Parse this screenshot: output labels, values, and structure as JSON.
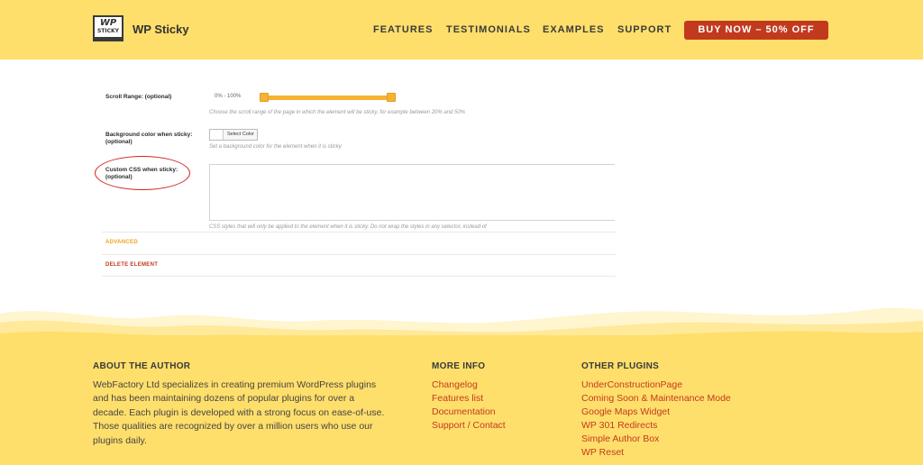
{
  "header": {
    "logo_line1": "WP",
    "logo_line2": "STICKY",
    "brand": "WP Sticky",
    "nav": [
      "FEATURES",
      "TESTIMONIALS",
      "EXAMPLES",
      "SUPPORT"
    ],
    "buy_label": "BUY NOW – 50% OFF"
  },
  "settings": {
    "scroll_range": {
      "label": "Scroll Range: (optional)",
      "value_text": "0% - 100%",
      "range_percent": [
        0,
        100
      ],
      "hint": "Choose the scroll range of the page in which the element will be sticky, for example between 20% and 50%"
    },
    "background": {
      "label": "Background color when sticky: (optional)",
      "button_label": "Select Color",
      "hint": "Set a background color for the element when it is sticky."
    },
    "custom_css": {
      "label_line1": "Custom CSS when sticky:",
      "label_line2": "(optional)",
      "value": "",
      "hint": "CSS styles that will only be applied to the element when it is sticky. Do not wrap the styles in any selector, instead of"
    },
    "advanced_label": "ADVANCED",
    "delete_label": "DELETE ELEMENT"
  },
  "footer": {
    "about": {
      "heading": "ABOUT THE AUTHOR",
      "lines": [
        "WebFactory Ltd specializes in creating premium WordPress plugins",
        "and has been maintaining dozens of popular plugins for over a",
        "decade. Each plugin is developed with a strong focus on ease-of-use.",
        "Those qualities are recognized by over a million users who use our",
        "plugins daily."
      ]
    },
    "more_info": {
      "heading": "MORE INFO",
      "links": [
        "Changelog",
        "Features list",
        "Documentation",
        "Support / Contact"
      ]
    },
    "other_plugins": {
      "heading": "OTHER PLUGINS",
      "links": [
        "UnderConstructionPage",
        "Coming Soon & Maintenance Mode",
        "Google Maps Widget",
        "WP 301 Redirects",
        "Simple Author Box",
        "WP Reset"
      ]
    }
  },
  "colors": {
    "header_bg": "#ffdf6b",
    "accent_red": "#c23a1e",
    "slider_orange": "#f5b233",
    "annotation_circle": "#d02020"
  }
}
